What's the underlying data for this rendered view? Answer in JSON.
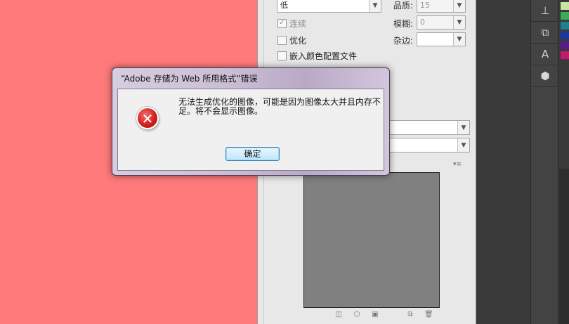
{
  "dialog": {
    "title": "“Adobe 存储为 Web 所用格式”错误",
    "message": "无法生成优化的图像，可能是因为图像太大并且内存不足。将不会显示图像。",
    "ok_label": "确定",
    "icon": "error-x-icon"
  },
  "settings": {
    "quality_level": "低",
    "quality_label": "品质:",
    "quality_value": "15",
    "blur_label": "模糊:",
    "blur_value": "0",
    "matte_label": "杂边:",
    "continuous_label": "连续",
    "continuous_checked": true,
    "optimized_label": "优化",
    "optimized_checked": false,
    "embed_profile_label": "嵌入颜色配置文件",
    "embed_profile_checked": false
  },
  "colors": {
    "canvas_background": "#ff7a7a",
    "image_thumb": "#808080",
    "toolbar_dark": "#3a3a3a",
    "swatches": [
      "#c8e6a0",
      "#3caa5a",
      "#1e7f8f",
      "#1a3aa0",
      "#5a1a8a",
      "#c8186e"
    ]
  },
  "toolbar_icons": [
    "stamp-icon",
    "shapes-icon",
    "text-icon",
    "cube-icon"
  ]
}
